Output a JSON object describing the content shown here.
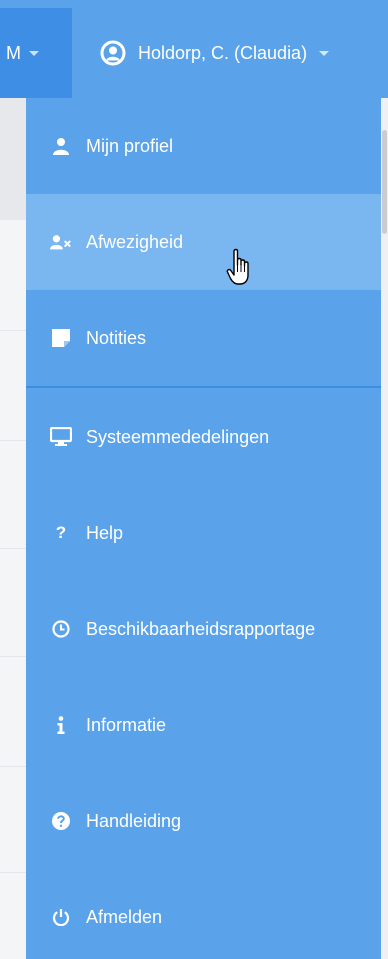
{
  "topbar": {
    "left_label": "M",
    "user_name": "Holdorp, C. (Claudia)"
  },
  "menu": {
    "items": [
      {
        "label": "Mijn profiel",
        "icon": "user-icon"
      },
      {
        "label": "Afwezigheid",
        "icon": "user-times-icon"
      },
      {
        "label": "Notities",
        "icon": "sticky-note-icon"
      },
      {
        "label": "Systeemmededelingen",
        "icon": "monitor-icon"
      },
      {
        "label": "Help",
        "icon": "question-mark-icon"
      },
      {
        "label": "Beschikbaarheidsrapportage",
        "icon": "clock-icon"
      },
      {
        "label": "Informatie",
        "icon": "info-icon"
      },
      {
        "label": "Handleiding",
        "icon": "question-circle-icon"
      },
      {
        "label": "Afmelden",
        "icon": "power-icon"
      }
    ],
    "hovered_item": "Afwezigheid"
  },
  "colors": {
    "menu_bg": "#5aa3ea",
    "menu_hover": "#7ab6ef",
    "left_segment": "#3f8ee6",
    "separator": "#3d8de2",
    "text": "#ffffff"
  }
}
